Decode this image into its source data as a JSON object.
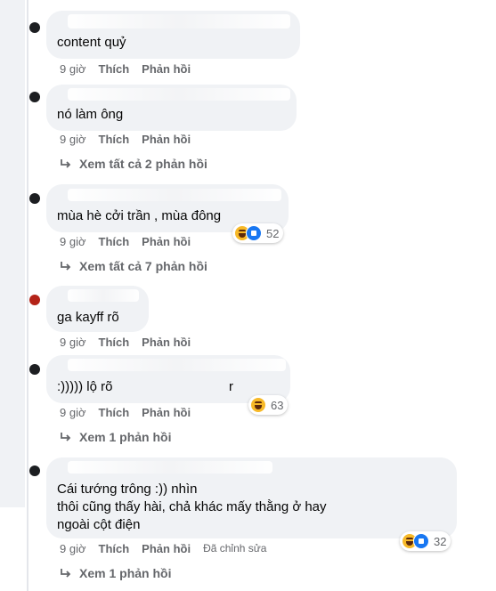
{
  "comments": [
    {
      "text": "content quỷ",
      "time": "9 giờ",
      "like": "Thích",
      "reply": "Phản hồi"
    },
    {
      "text": "nó làm      ông",
      "time": "9 giờ",
      "like": "Thích",
      "reply": "Phản hồi",
      "view_replies": "Xem tất cả 2 phản hồi"
    },
    {
      "text": "mùa hè cởi trần , mùa đông",
      "time": "9 giờ",
      "like": "Thích",
      "reply": "Phản hồi",
      "view_replies": "Xem tất cả 7 phản hồi",
      "reaction_count": "52"
    },
    {
      "text": "ga kayff rõ",
      "time": "9 giờ",
      "like": "Thích",
      "reply": "Phản hồi"
    },
    {
      "text": ":))))) lộ rõ",
      "text_end": "r",
      "time": "9 giờ",
      "like": "Thích",
      "reply": "Phản hồi",
      "view_replies": "Xem 1 phản hồi",
      "reaction_count": "63"
    },
    {
      "text_line1": "Cái        tướng                                      trông              :)) nhìn",
      "text_line2": "thôi cũng thấy hài, chả khác mấy thằng              ở hay",
      "text_line3": "ngoài cột điện",
      "time": "9 giờ",
      "like": "Thích",
      "reply": "Phản hồi",
      "edited": "Đã chỉnh sửa",
      "view_replies": "Xem 1 phản hồi",
      "reaction_count": "32"
    }
  ],
  "colors": {
    "bubble": "#f0f2f5",
    "meta": "#65676b",
    "text": "#050505",
    "like_blue": "#1877f2",
    "haha_yellow": "#f7b928"
  },
  "icons": [
    "reply-arrow-icon",
    "haha-reaction-icon",
    "like-reaction-icon"
  ]
}
